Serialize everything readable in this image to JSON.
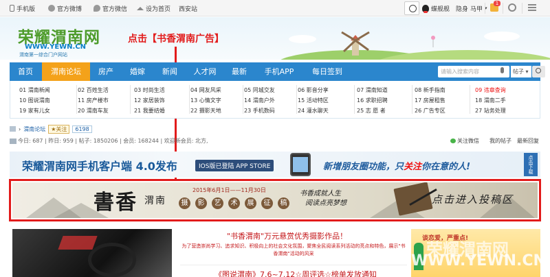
{
  "topbar": {
    "mobile": "手机版",
    "weibo": "官方微博",
    "wechat": "官方微信",
    "home": "设为首页",
    "site": "西安站",
    "user": "蝶舰舰",
    "stealth": "隐身",
    "level": "马甲",
    "mail_count": "1"
  },
  "header": {
    "logo_cn": "荣耀渭南网",
    "logo_url": "WWW.YEWN.CN",
    "logo_slogan": "渭南第一综合门户网站",
    "annotation": "点击【书香渭南广告】"
  },
  "nav": {
    "items": [
      "首页",
      "渭南论坛",
      "房产",
      "婚嫁",
      "新闻",
      "人才网",
      "最新",
      "手机APP",
      "每日签到"
    ],
    "search_placeholder": "请输入搜索内容",
    "search_type": "帖子"
  },
  "subnav": {
    "col1": [
      "01 渭南新闻",
      "10 图说渭南",
      "19 家有儿女"
    ],
    "col2": [
      "02 百姓生活",
      "11 房产楼市",
      "20 渭南车友"
    ],
    "col3": [
      "03 时尚生活",
      "12 家居装饰",
      "21 我要结婚"
    ],
    "col4": [
      "04 网友风采",
      "13 心情文字",
      "22 摄影天地"
    ],
    "col5": [
      "05 同城交友",
      "14 渭南户外",
      "23 手机数码"
    ],
    "col6": [
      "06 影音分享",
      "15 活动特区",
      "24 灌水聊天"
    ],
    "col7": [
      "07 渭南知道",
      "16 求职招聘",
      "25 志 愿 者"
    ],
    "col8": [
      "08 新手指南",
      "17 房屋租售",
      "26 广告专区"
    ],
    "col9": [
      "09 违章查询",
      "18 渭南二手",
      "27 站务处理"
    ]
  },
  "crumb": {
    "forum": "渭南论坛",
    "follow": "关注",
    "count": "6198"
  },
  "stats": {
    "text": "今日: 687 | 昨日: 959 | 帖子: 1850206 | 会员: 168244 | 欢迎新会员: 北方,",
    "wechat": "关注微信",
    "my_posts": "我的帖子",
    "latest_reply": "最新回复"
  },
  "banner1": {
    "title": "荣耀渭南网手机客户端 4.0发布",
    "ios": "IOS版已登陆 APP STORE",
    "slogan_a": "新增",
    "slogan_b": "朋友圈",
    "slogan_c": "功能，只",
    "slogan_d": "关注",
    "slogan_e": "你在意的人!",
    "download": "点击下载"
  },
  "banner2": {
    "shuxiang": "書香",
    "weinan": "渭南",
    "date": "2015年6月1日——11月30日",
    "seals": [
      "摄",
      "影",
      "艺",
      "术",
      "展",
      "征",
      "稿"
    ],
    "quote1": "书香成就人生",
    "quote2": "阅读点亮梦想",
    "cta": "点击进入投稿区"
  },
  "news": {
    "title": "\"书香渭南\"万元悬赏优秀摄影作品！",
    "desc": "为了营造崇尚学习、追求知识、积极向上的社会文化氛围，聚焦全民阅读系列活动的亮点和特色，展示\"书香渭南\"活动的风采",
    "title2": "《图说渭南》7.6~7.12☆周评选☆榜单发放通知"
  },
  "side_ad": {
    "text": "谈恋爱，严重点!",
    "watermark": "荣耀渭南网",
    "url": "WWW.YEWN.CN"
  },
  "colors": {
    "nav_blue": "#2b86cd",
    "nav_active": "#f4a21a",
    "highlight_red": "#e21b1b"
  }
}
